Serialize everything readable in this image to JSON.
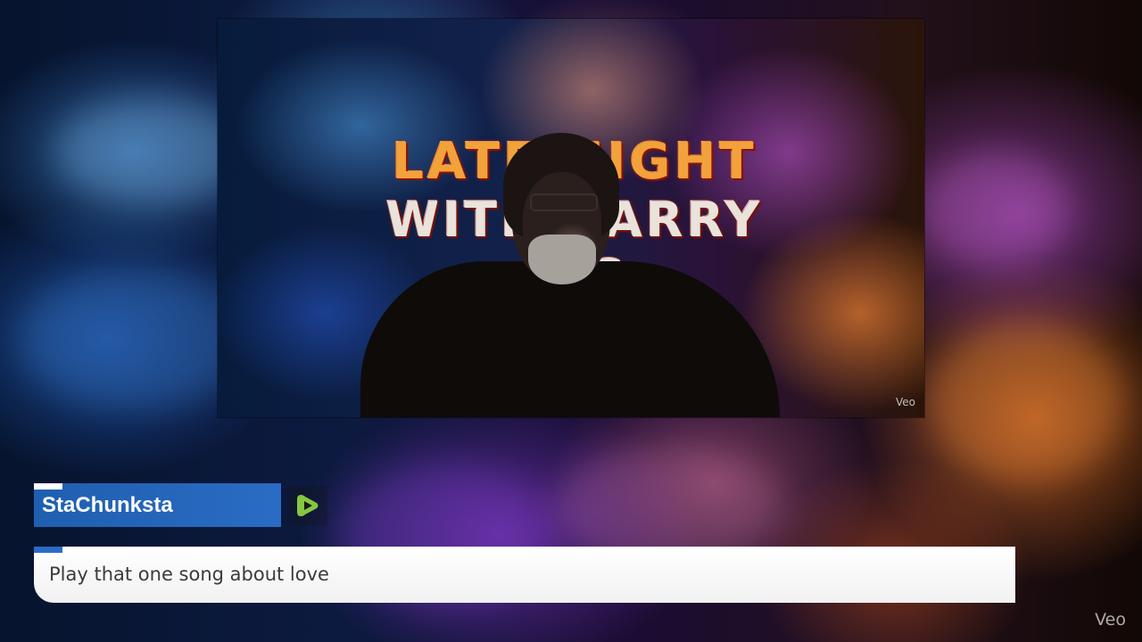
{
  "video": {
    "show_title_line1": "LATE NIGHT",
    "show_title_line2": "WITH BARRY NIC",
    "watermark": "Veo"
  },
  "overlay": {
    "corner_watermark": "Veo"
  },
  "chat": {
    "username": "StaChunksta",
    "platform_icon": "rumble-play-icon",
    "message": "Play that one song about love",
    "accent_color": "#2a6cc4",
    "badge_color": "#85c742"
  }
}
